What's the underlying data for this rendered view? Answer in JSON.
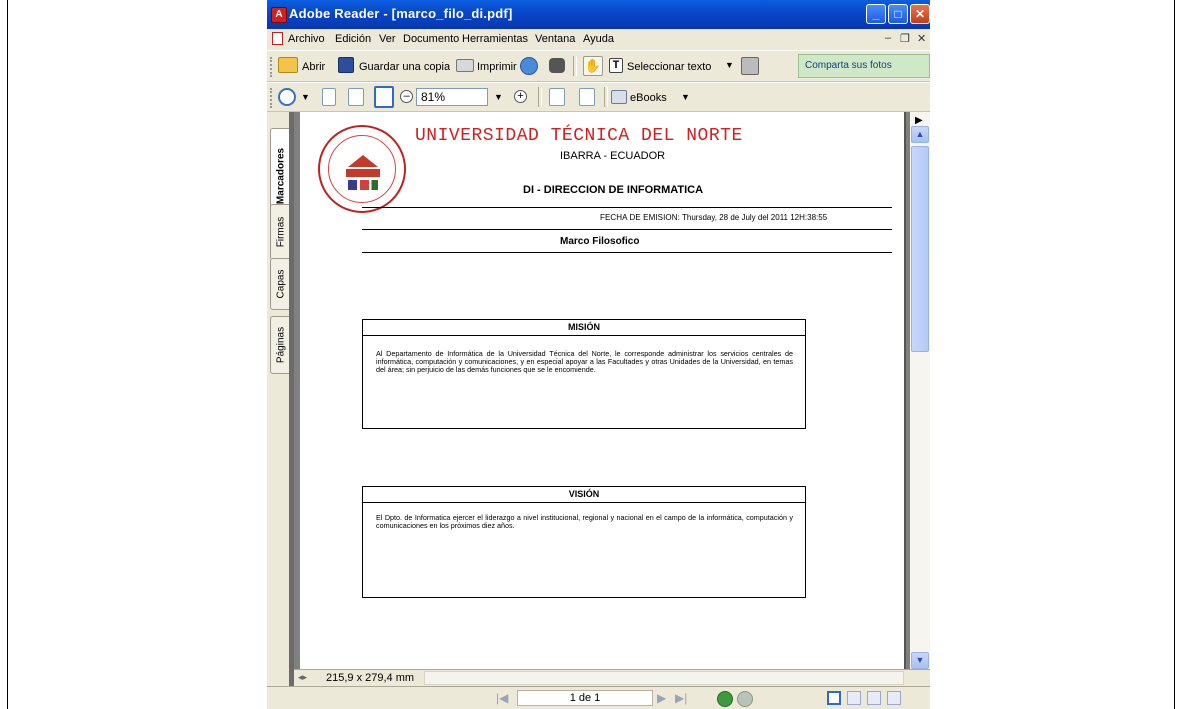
{
  "window": {
    "title": "Adobe Reader - [marco_filo_di.pdf]",
    "app_icon": "adobe-reader-icon"
  },
  "menu": {
    "items": [
      "Archivo",
      "Edición",
      "Ver",
      "Documento",
      "Herramientas",
      "Ventana",
      "Ayuda"
    ]
  },
  "toolbar1": {
    "open_label": "Abrir",
    "save_label": "Guardar una copia",
    "print_label": "Imprimir",
    "select_text_label": "Seleccionar texto",
    "ad_text": "Comparta sus fotos digitales"
  },
  "toolbar2": {
    "zoom_value": "81%",
    "ebooks_label": "eBooks"
  },
  "nav_panel": {
    "tabs": [
      "Marcadores",
      "Firmas",
      "Capas",
      "Páginas"
    ],
    "active_tab": "Marcadores"
  },
  "document": {
    "university": "UNIVERSIDAD TÉCNICA DEL NORTE",
    "city": "IBARRA - ECUADOR",
    "department": "DI - DIRECCION DE INFORMATICA",
    "emission_label": "FECHA DE EMISION:",
    "emission_value": "Thursday, 28 de July del 2011  12H:38:55",
    "title": "Marco Filosofico",
    "mission_heading": "MISIÓN",
    "mission_text": "Al Departamento de Informática de la Universidad Técnica del Norte, le corresponde administrar los servicios centrales de informática, computación y comunicaciones, y en especial apoyar a las Facultades y otras Unidades de la Universidad, en temas del área; sin perjuicio de las demás funciones que se le encomiende.",
    "vision_heading": "VISIÓN",
    "vision_text": "El Dpto. de Informatica ejercer el liderazgo a nivel institucional, regional y nacional en el campo de la informática, computación y comunicaciones en los próximos diez años."
  },
  "page_size": "215,9 x 279,4 mm",
  "status": {
    "page_indicator": "1 de 1"
  },
  "colors": {
    "titlebar": "#0846c7",
    "chrome": "#ece9d8",
    "university_red": "#d02020"
  }
}
